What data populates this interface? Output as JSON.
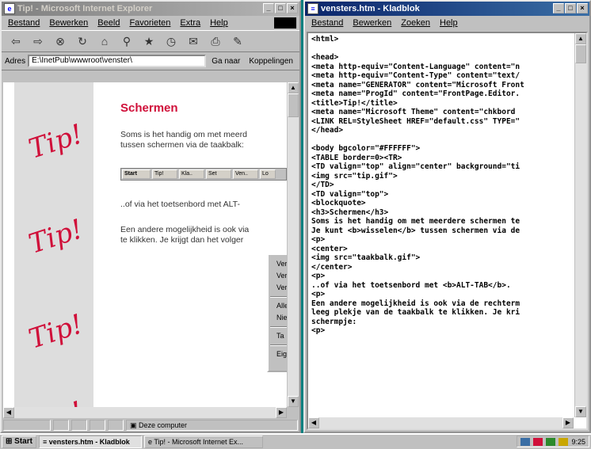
{
  "ie_window": {
    "title": "Tip! - Microsoft Internet Explorer",
    "menu": [
      "Bestand",
      "Bewerken",
      "Beeld",
      "Favorieten",
      "Extra",
      "Help"
    ],
    "toolbar_icons": [
      "back-icon",
      "forward-icon",
      "stop-icon",
      "refresh-icon",
      "home-icon",
      "search-icon",
      "favorites-icon",
      "history-icon",
      "mail-icon",
      "print-icon",
      "edit-icon"
    ],
    "address_label": "Adres",
    "address_value": "E:\\InetPub\\wwwroot\\venster\\",
    "go_label": "Ga naar",
    "links_label": "Koppelingen",
    "status_zone": "Deze computer",
    "page": {
      "tip_words": [
        "Tip!",
        "Tip!",
        "Tip!",
        "Tip!"
      ],
      "heading": "Schermen",
      "para1_line1": "Soms is het handig om met meerd",
      "para1_line2": "tussen schermen via de taakbalk:",
      "taskbar_image_items": [
        "Start",
        "Tip!",
        "Kla..",
        "Set",
        "Ven..",
        "Lo"
      ],
      "para2": "..of via het toetsenbord met ALT-",
      "para3_line1": "Een andere mogelijkheid is ook via",
      "para3_line2": "te klikken. Je krijgt dan het volger",
      "context_menu": [
        "Ver",
        "Ver",
        "Ver",
        "Alle",
        "Nie",
        "Ta",
        "Eig"
      ]
    }
  },
  "notepad_window": {
    "title": "vensters.htm - Kladblok",
    "menu": [
      "Bestand",
      "Bewerken",
      "Zoeken",
      "Help"
    ],
    "code_lines": [
      "<html>",
      "",
      "<head>",
      "<meta http-equiv=\"Content-Language\" content=\"n",
      "<meta http-equiv=\"Content-Type\" content=\"text/",
      "<meta name=\"GENERATOR\" content=\"Microsoft Front",
      "<meta name=\"ProgId\" content=\"FrontPage.Editor.",
      "<title>Tip!</title>",
      "<meta name=\"Microsoft Theme\" content=\"chkbord",
      "<LINK REL=StyleSheet HREF=\"default.css\" TYPE=\"",
      "</head>",
      "",
      "<body bgcolor=\"#FFFFFF\">",
      "<TABLE border=0><TR>",
      "<TD valign=\"top\" align=\"center\" background=\"ti",
      "<img src=\"tip.gif\">",
      "</TD>",
      "<TD valign=\"top\">",
      "<blockquote>",
      "<h3>Schermen</h3>",
      "Soms is het handig om met meerdere schermen te",
      "Je kunt <b>wisselen</b> tussen schermen via de",
      "<p>",
      "<center>",
      "<img src=\"taakbalk.gif\">",
      "</center>",
      "<p>",
      "..of via het toetsenbord met <b>ALT-TAB</b>.",
      "<p>",
      "Een andere mogelijkheid is ook via de rechterm",
      "leeg plekje van de taakbalk te klikken. Je kri",
      "schermpje:",
      "<p>"
    ]
  },
  "taskbar": {
    "start_label": "Start",
    "buttons": [
      "vensters.htm - Kladblok",
      "Tip! - Microsoft Internet Ex..."
    ],
    "clock": "9:25"
  }
}
